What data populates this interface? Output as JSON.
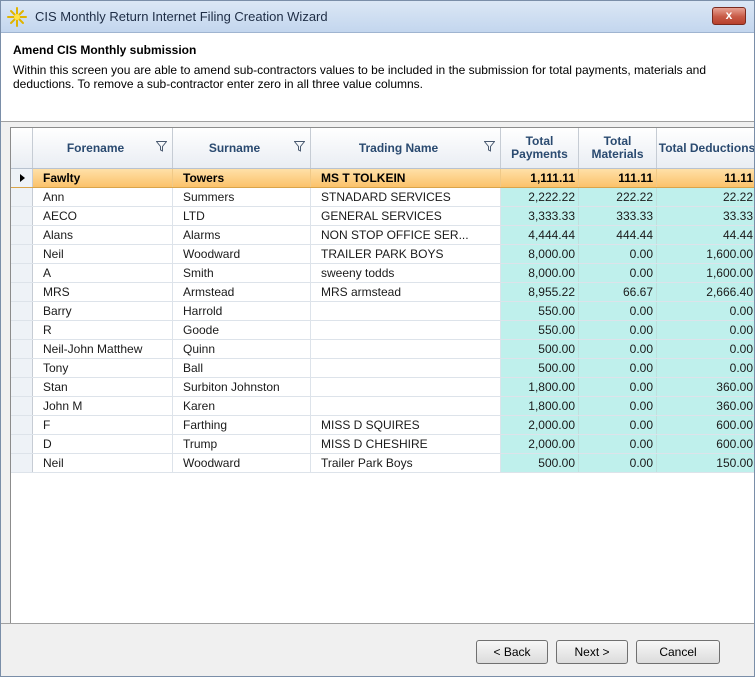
{
  "window": {
    "title": "CIS Monthly Return Internet Filing Creation Wizard",
    "close_label": "x"
  },
  "header": {
    "heading": "Amend CIS Monthly submission",
    "description": "Within this screen you are able to amend sub-contractors values to be included in the submission for total payments, materials and deductions. To remove a sub-contractor enter zero in all three value columns."
  },
  "grid": {
    "columns": {
      "forename": "Forename",
      "surname": "Surname",
      "trading_name": "Trading Name",
      "total_payments": "Total Payments",
      "total_materials": "Total Materials",
      "total_deductions": "Total Deductions"
    },
    "rows": [
      {
        "forename": "Fawlty",
        "surname": "Towers",
        "trading_name": "MS T TOLKEIN",
        "payments": "1,111.11",
        "materials": "111.11",
        "deductions": "11.11",
        "selected": true
      },
      {
        "forename": "Ann",
        "surname": "Summers",
        "trading_name": "STNADARD SERVICES",
        "payments": "2,222.22",
        "materials": "222.22",
        "deductions": "22.22"
      },
      {
        "forename": "AECO",
        "surname": "LTD",
        "trading_name": "GENERAL SERVICES",
        "payments": "3,333.33",
        "materials": "333.33",
        "deductions": "33.33"
      },
      {
        "forename": "Alans",
        "surname": "Alarms",
        "trading_name": "NON STOP OFFICE SER...",
        "payments": "4,444.44",
        "materials": "444.44",
        "deductions": "44.44"
      },
      {
        "forename": "Neil",
        "surname": "Woodward",
        "trading_name": "TRAILER PARK BOYS",
        "payments": "8,000.00",
        "materials": "0.00",
        "deductions": "1,600.00"
      },
      {
        "forename": "A",
        "surname": "Smith",
        "trading_name": "sweeny todds",
        "payments": "8,000.00",
        "materials": "0.00",
        "deductions": "1,600.00"
      },
      {
        "forename": "MRS",
        "surname": "Armstead",
        "trading_name": "MRS armstead",
        "payments": "8,955.22",
        "materials": "66.67",
        "deductions": "2,666.40"
      },
      {
        "forename": "Barry",
        "surname": "Harrold",
        "trading_name": "",
        "payments": "550.00",
        "materials": "0.00",
        "deductions": "0.00"
      },
      {
        "forename": "R",
        "surname": "Goode",
        "trading_name": "",
        "payments": "550.00",
        "materials": "0.00",
        "deductions": "0.00"
      },
      {
        "forename": "Neil-John Matthew",
        "surname": "Quinn",
        "trading_name": "",
        "payments": "500.00",
        "materials": "0.00",
        "deductions": "0.00"
      },
      {
        "forename": "Tony",
        "surname": "Ball",
        "trading_name": "",
        "payments": "500.00",
        "materials": "0.00",
        "deductions": "0.00"
      },
      {
        "forename": "Stan",
        "surname": "Surbiton Johnston",
        "trading_name": "",
        "payments": "1,800.00",
        "materials": "0.00",
        "deductions": "360.00"
      },
      {
        "forename": "John M",
        "surname": "Karen",
        "trading_name": "",
        "payments": "1,800.00",
        "materials": "0.00",
        "deductions": "360.00"
      },
      {
        "forename": "F",
        "surname": "Farthing",
        "trading_name": "MISS D SQUIRES",
        "payments": "2,000.00",
        "materials": "0.00",
        "deductions": "600.00"
      },
      {
        "forename": "D",
        "surname": "Trump",
        "trading_name": "MISS D CHESHIRE",
        "payments": "2,000.00",
        "materials": "0.00",
        "deductions": "600.00"
      },
      {
        "forename": "Neil",
        "surname": "Woodward",
        "trading_name": "Trailer Park Boys",
        "payments": "500.00",
        "materials": "0.00",
        "deductions": "150.00"
      }
    ]
  },
  "footer": {
    "back_label": "< Back",
    "next_label": "Next >",
    "cancel_label": "Cancel"
  },
  "colors": {
    "selected_row": "#fbc26a",
    "value_cell": "#bff0ec",
    "header_text": "#2a4a70"
  }
}
